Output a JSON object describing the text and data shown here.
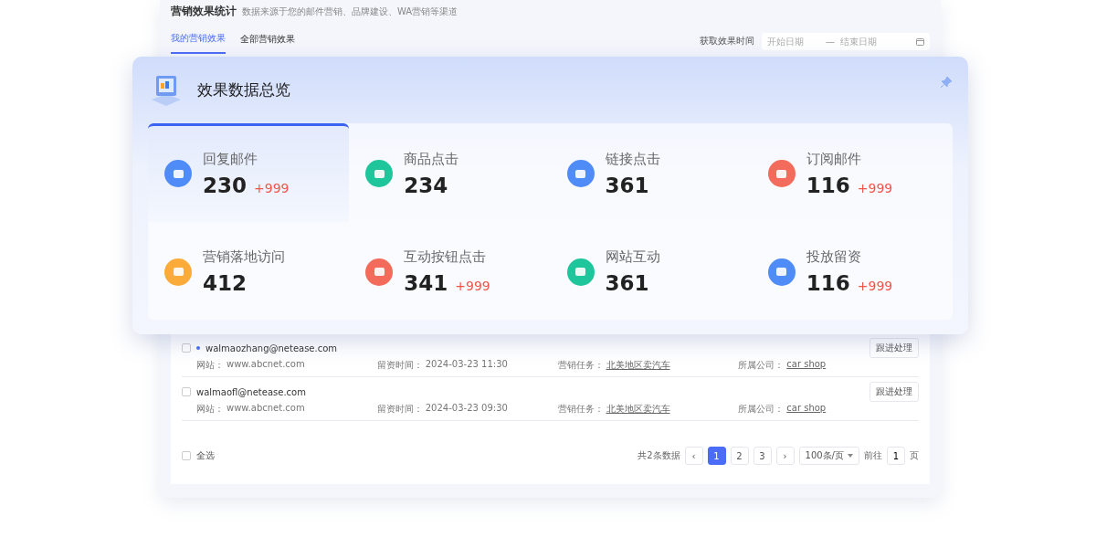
{
  "header": {
    "title": "营销效果统计",
    "subtitle": "数据来源于您的邮件营销、品牌建设、WA营销等渠道"
  },
  "tabs": [
    {
      "label": "我的营销效果",
      "selected": true
    },
    {
      "label": "全部营销效果",
      "selected": false
    }
  ],
  "date_filter": {
    "label": "获取效果时间",
    "start_placeholder": "开始日期",
    "separator": "—",
    "end_placeholder": "结束日期"
  },
  "overview": {
    "title": "效果数据总览",
    "stats": [
      {
        "label": "回复邮件",
        "value": "230",
        "delta": "+999",
        "color": "#4f8cf7",
        "selected": true
      },
      {
        "label": "商品点击",
        "value": "234",
        "color": "#1fc59b",
        "selected": false
      },
      {
        "label": "链接点击",
        "value": "361",
        "color": "#4f8cf7",
        "selected": false
      },
      {
        "label": "订阅邮件",
        "value": "116",
        "delta": "+999",
        "color": "#f26b5b",
        "selected": false
      },
      {
        "label": "营销落地访问",
        "value": "412",
        "color": "#fbab3a",
        "selected": false
      },
      {
        "label": "互动按钮点击",
        "value": "341",
        "delta": "+999",
        "color": "#f26b5b",
        "selected": false
      },
      {
        "label": "网站互动",
        "value": "361",
        "color": "#1fc59b",
        "selected": false
      },
      {
        "label": "投放留资",
        "value": "116",
        "delta": "+999",
        "color": "#4f8cf7",
        "selected": false
      }
    ]
  },
  "leads": [
    {
      "email": "walmaozhang@netease.com",
      "unread": true,
      "checked": false,
      "button": "跟进处理",
      "website_label": "网站：",
      "website": "www.abcnet.com",
      "time_label": "留资时间：",
      "time": "2024-03-23 11:30",
      "task_label": "营销任务：",
      "task": "北美地区卖汽车",
      "company_label": "所属公司：",
      "company": "car shop"
    },
    {
      "email": "walmaofl@netease.com",
      "unread": false,
      "checked": false,
      "button": "跟进处理",
      "website_label": "网站：",
      "website": "www.abcnet.com",
      "time_label": "留资时间：",
      "time": "2024-03-23 09:30",
      "task_label": "营销任务：",
      "task": "北美地区卖汽车",
      "company_label": "所属公司：",
      "company": "car shop"
    }
  ],
  "footer": {
    "select_all": "全选",
    "select_all_checked": false,
    "total": "共2条数据",
    "prev": "‹",
    "pages": [
      {
        "label": "1",
        "selected": true
      },
      {
        "label": "2",
        "selected": false
      },
      {
        "label": "3",
        "selected": false
      }
    ],
    "next": "›",
    "page_size": "100条/页",
    "goto_label": "前往",
    "goto_value": "1",
    "goto_suffix": "页"
  }
}
